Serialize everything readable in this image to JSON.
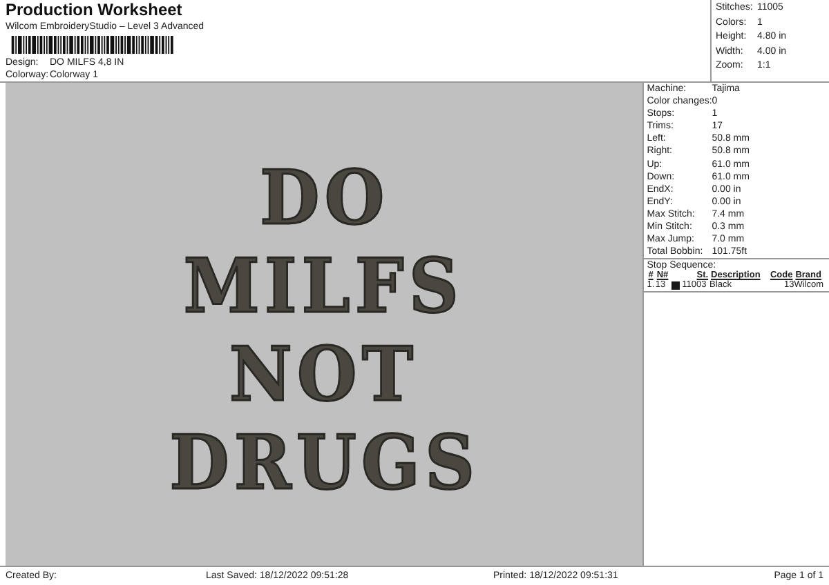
{
  "header": {
    "title": "Production Worksheet",
    "subtitle": "Wilcom EmbroideryStudio – Level 3 Advanced",
    "fields": [
      {
        "label": "Design:",
        "value": "DO MILFS 4,8 IN"
      },
      {
        "label": "Colorway:",
        "value": "Colorway 1"
      }
    ]
  },
  "summary": [
    {
      "label": "Stitches:",
      "value": "11005"
    },
    {
      "label": "Colors:",
      "value": "1"
    },
    {
      "label": "Height:",
      "value": "4.80 in"
    },
    {
      "label": "Width:",
      "value": "4.00 in"
    },
    {
      "label": "Zoom:",
      "value": "1:1"
    }
  ],
  "design": {
    "lines": [
      "DO",
      "MILFS",
      "NOT",
      "DRUGS"
    ]
  },
  "details": [
    {
      "label": "Machine:",
      "value": "Tajima"
    },
    {
      "label": "Color changes:",
      "value": "0"
    },
    {
      "label": "Stops:",
      "value": "1"
    },
    {
      "label": "Trims:",
      "value": "17"
    },
    {
      "label": "Left:",
      "value": "50.8 mm"
    },
    {
      "label": "Right:",
      "value": "50.8 mm"
    },
    {
      "label": "Up:",
      "value": "61.0 mm"
    },
    {
      "label": "Down:",
      "value": "61.0 mm"
    },
    {
      "label": "EndX:",
      "value": "0.00 in"
    },
    {
      "label": "EndY:",
      "value": "0.00 in"
    },
    {
      "label": "Max Stitch:",
      "value": "7.4 mm"
    },
    {
      "label": "Min Stitch:",
      "value": "0.3 mm"
    },
    {
      "label": "Max Jump:",
      "value": "7.0 mm"
    },
    {
      "label": "Total Bobbin:",
      "value": "101.75ft"
    }
  ],
  "stop_sequence": {
    "title": "Stop Sequence:",
    "columns": [
      "#",
      "N#",
      "St.",
      "Description",
      "Code",
      "Brand"
    ],
    "rows": [
      {
        "index": "1.",
        "needle": "13",
        "color": "#1a1a1a",
        "stitches": "11003",
        "description": "Black",
        "code": "13",
        "brand": "Wilcom"
      }
    ]
  },
  "footer": {
    "created": "Created By:",
    "saved": "Last Saved: 18/12/2022 09:51:28",
    "printed": "Printed: 18/12/2022 09:51:31",
    "page": "Page 1 of 1"
  }
}
